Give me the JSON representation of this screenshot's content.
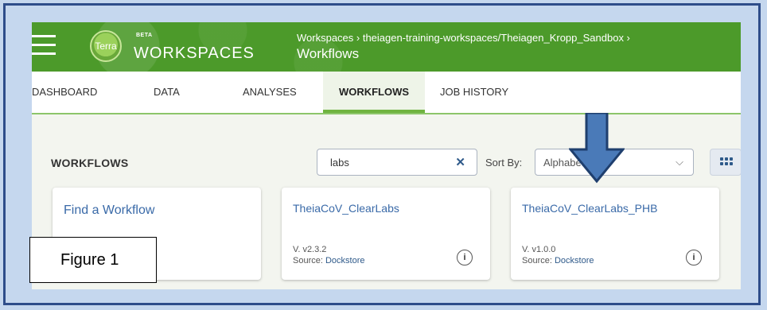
{
  "header": {
    "logo_text": "Terra",
    "beta": "BETA",
    "app_title": "WORKSPACES",
    "breadcrumb": "Workspaces › theiagen-training-workspaces/Theiagen_Kropp_Sandbox ›",
    "page_title": "Workflows"
  },
  "tabs": [
    {
      "label": "DASHBOARD",
      "active": false
    },
    {
      "label": "DATA",
      "active": false
    },
    {
      "label": "ANALYSES",
      "active": false
    },
    {
      "label": "WORKFLOWS",
      "active": true
    },
    {
      "label": "JOB HISTORY",
      "active": false
    }
  ],
  "toolbar": {
    "section_title": "WORKFLOWS",
    "search_value": "labs",
    "clear_icon": "close-icon",
    "sort_label": "Sort By:",
    "sort_value": "Alphabet",
    "view_icon": "grid-view-icon"
  },
  "cards": [
    {
      "title": "Find a Workflow"
    },
    {
      "title": "TheiaCoV_ClearLabs",
      "version": "V. v2.3.2",
      "source_label": "Source: ",
      "source_link": "Dockstore"
    },
    {
      "title": "TheiaCoV_ClearLabs_PHB",
      "version": "V. v1.0.0",
      "source_label": "Source: ",
      "source_link": "Dockstore"
    }
  ],
  "annotations": {
    "figure_label": "Figure 1",
    "arrow_color": "#4a7ab8"
  },
  "colors": {
    "header_green": "#4c9a2a",
    "link_blue": "#3a6aa8",
    "frame_border": "#2e4d8a"
  }
}
